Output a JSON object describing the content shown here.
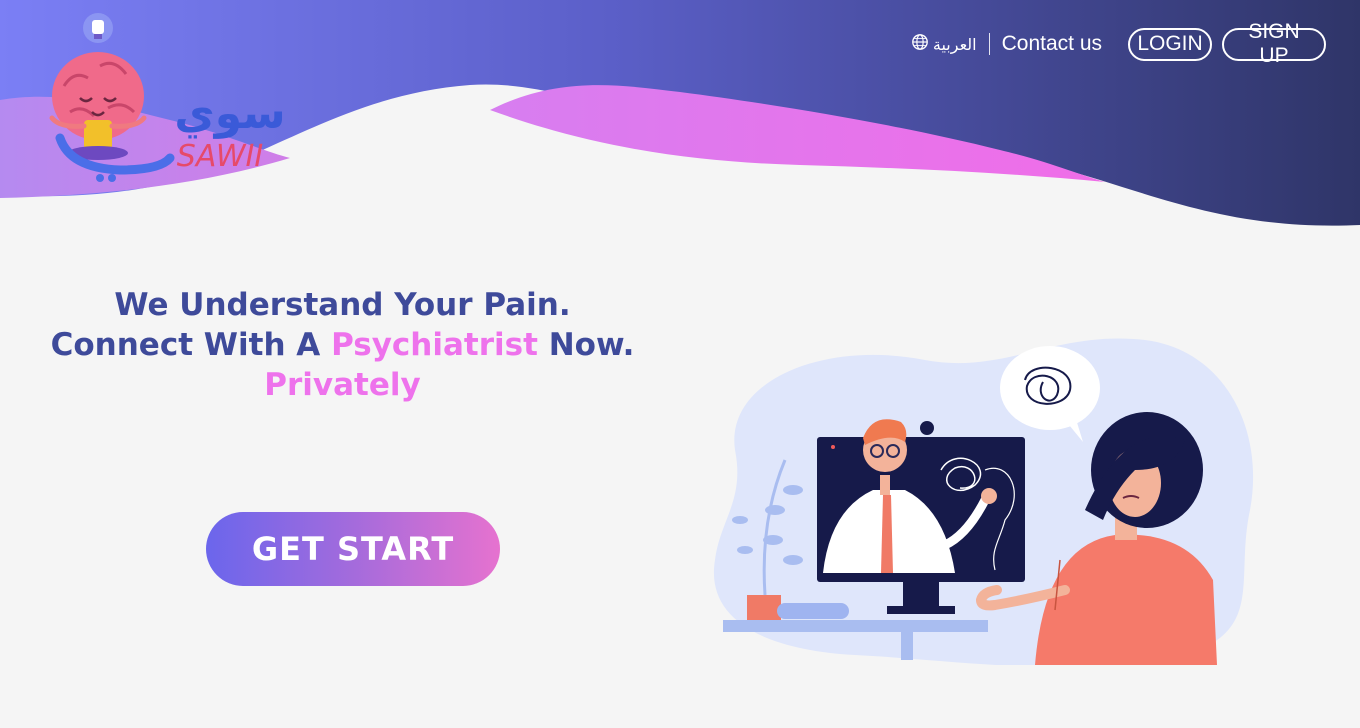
{
  "brand": {
    "name": "SAWII",
    "arabic_name": "سوي"
  },
  "nav": {
    "language": "العربية",
    "language_icon": "globe-icon",
    "contact": "Contact us",
    "login": "LOGIN",
    "signup": "SIGN UP"
  },
  "hero": {
    "line1": "We Understand Your Pain.",
    "line2_start": "Connect With A ",
    "line2_highlight": "Psychiatrist",
    "line2_end": " Now.",
    "line3": "Privately",
    "cta": "GET START"
  },
  "colors": {
    "header_gradient_start": "#7b7ff5",
    "header_gradient_end": "#2f3568",
    "accent_pink": "#ee72ec",
    "headline_blue": "#3e4a9a",
    "background": "#f5f5f5"
  }
}
